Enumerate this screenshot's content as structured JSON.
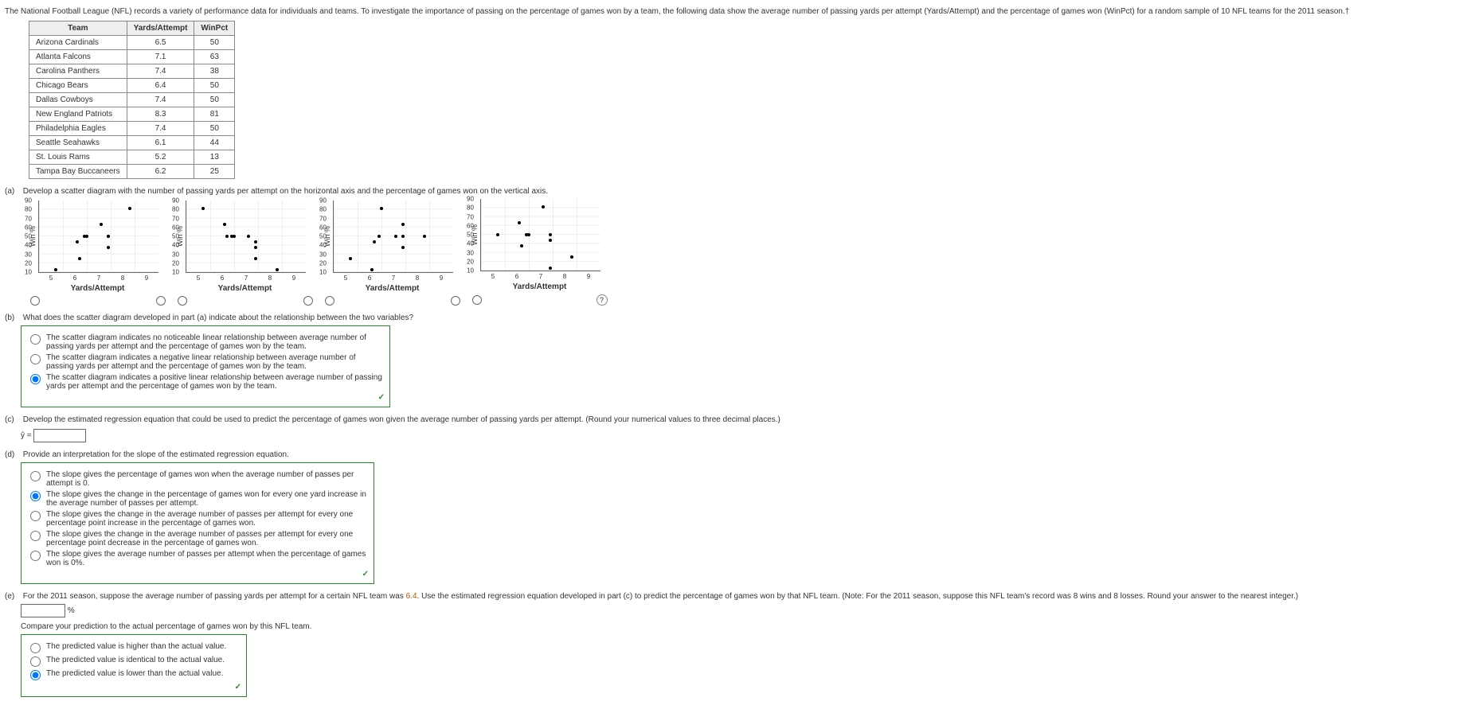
{
  "intro": "The National Football League (NFL) records a variety of performance data for individuals and teams. To investigate the importance of passing on the percentage of games won by a team, the following data show the average number of passing yards per attempt (Yards/Attempt) and the percentage of games won (WinPct) for a random sample of 10 NFL teams for the 2011 season.†",
  "table": {
    "headers": [
      "Team",
      "Yards/Attempt",
      "WinPct"
    ],
    "rows": [
      [
        "Arizona Cardinals",
        "6.5",
        "50"
      ],
      [
        "Atlanta Falcons",
        "7.1",
        "63"
      ],
      [
        "Carolina Panthers",
        "7.4",
        "38"
      ],
      [
        "Chicago Bears",
        "6.4",
        "50"
      ],
      [
        "Dallas Cowboys",
        "7.4",
        "50"
      ],
      [
        "New England Patriots",
        "8.3",
        "81"
      ],
      [
        "Philadelphia Eagles",
        "7.4",
        "50"
      ],
      [
        "Seattle Seahawks",
        "6.1",
        "44"
      ],
      [
        "St. Louis Rams",
        "5.2",
        "13"
      ],
      [
        "Tampa Bay Buccaneers",
        "6.2",
        "25"
      ]
    ]
  },
  "a": {
    "label": "(a)",
    "text": "Develop a scatter diagram with the number of passing yards per attempt on the horizontal axis and the percentage of games won on the vertical axis.",
    "ylabel": "Win %",
    "xlabel": "Yards/Attempt"
  },
  "chart_data": [
    {
      "type": "scatter",
      "xlabel": "Yards/Attempt",
      "ylabel": "Win %",
      "xlim": [
        4.5,
        9.5
      ],
      "ylim": [
        10,
        90
      ],
      "yticks": [
        10,
        20,
        30,
        40,
        50,
        60,
        70,
        80,
        90
      ],
      "xticks": [
        5,
        6,
        7,
        8,
        9
      ],
      "points": [
        [
          6.5,
          50
        ],
        [
          7.1,
          63
        ],
        [
          7.4,
          38
        ],
        [
          6.4,
          50
        ],
        [
          7.4,
          50
        ],
        [
          8.3,
          81
        ],
        [
          7.4,
          50
        ],
        [
          6.1,
          44
        ],
        [
          5.2,
          13
        ],
        [
          6.2,
          25
        ]
      ],
      "selected": false
    },
    {
      "type": "scatter",
      "xlabel": "Yards/Attempt",
      "ylabel": "Win %",
      "xlim": [
        4.5,
        9.5
      ],
      "ylim": [
        10,
        90
      ],
      "yticks": [
        10,
        20,
        30,
        40,
        50,
        60,
        70,
        80,
        90
      ],
      "xticks": [
        5,
        6,
        7,
        8,
        9
      ],
      "points": [
        [
          5.2,
          81
        ],
        [
          6.1,
          63
        ],
        [
          6.2,
          50
        ],
        [
          6.4,
          50
        ],
        [
          6.5,
          50
        ],
        [
          7.1,
          50
        ],
        [
          7.4,
          44
        ],
        [
          7.4,
          38
        ],
        [
          7.4,
          25
        ],
        [
          8.3,
          13
        ]
      ],
      "selected": false
    },
    {
      "type": "scatter",
      "xlabel": "Yards/Attempt",
      "ylabel": "Win %",
      "xlim": [
        4.5,
        9.5
      ],
      "ylim": [
        10,
        90
      ],
      "yticks": [
        10,
        20,
        30,
        40,
        50,
        60,
        70,
        80,
        90
      ],
      "xticks": [
        5,
        6,
        7,
        8,
        9
      ],
      "points": [
        [
          8.3,
          50
        ],
        [
          7.4,
          63
        ],
        [
          7.4,
          38
        ],
        [
          7.4,
          50
        ],
        [
          7.1,
          50
        ],
        [
          6.5,
          81
        ],
        [
          6.4,
          50
        ],
        [
          6.2,
          44
        ],
        [
          6.1,
          13
        ],
        [
          5.2,
          25
        ]
      ],
      "selected": false
    },
    {
      "type": "scatter",
      "xlabel": "Yards/Attempt",
      "ylabel": "Win %",
      "xlim": [
        4.5,
        9.5
      ],
      "ylim": [
        10,
        90
      ],
      "yticks": [
        10,
        20,
        30,
        40,
        50,
        60,
        70,
        80,
        90
      ],
      "xticks": [
        5,
        6,
        7,
        8,
        9
      ],
      "points": [
        [
          5.2,
          50
        ],
        [
          6.1,
          63
        ],
        [
          6.2,
          38
        ],
        [
          6.4,
          50
        ],
        [
          6.5,
          50
        ],
        [
          7.1,
          81
        ],
        [
          7.4,
          50
        ],
        [
          7.4,
          44
        ],
        [
          7.4,
          13
        ],
        [
          8.3,
          25
        ]
      ],
      "selected": false
    }
  ],
  "b": {
    "label": "(b)",
    "text": "What does the scatter diagram developed in part (a) indicate about the relationship between the two variables?",
    "options": [
      {
        "text": "The scatter diagram indicates no noticeable linear relationship between average number of passing yards per attempt and the percentage of games won by the team.",
        "selected": false
      },
      {
        "text": "The scatter diagram indicates a negative linear relationship between average number of passing yards per attempt and the percentage of games won by the team.",
        "selected": false
      },
      {
        "text": "The scatter diagram indicates a positive linear relationship between average number of passing yards per attempt and the percentage of games won by the team.",
        "selected": true
      }
    ]
  },
  "c": {
    "label": "(c)",
    "text": "Develop the estimated regression equation that could be used to predict the percentage of games won given the average number of passing yards per attempt. (Round your numerical values to three decimal places.)",
    "yhat": "ŷ ="
  },
  "d": {
    "label": "(d)",
    "text": "Provide an interpretation for the slope of the estimated regression equation.",
    "options": [
      {
        "text": "The slope gives the percentage of games won when the average number of passes per attempt is 0.",
        "selected": false
      },
      {
        "text": "The slope gives the change in the percentage of games won for every one yard increase in the average number of passes per attempt.",
        "selected": true
      },
      {
        "text": "The slope gives the change in the average number of passes per attempt for every one percentage point increase in the percentage of games won.",
        "selected": false
      },
      {
        "text": "The slope gives the change in the average number of passes per attempt for every one percentage point decrease in the percentage of games won.",
        "selected": false
      },
      {
        "text": "The slope gives the average number of passes per attempt when the percentage of games won is 0%.",
        "selected": false
      }
    ]
  },
  "e": {
    "label": "(e)",
    "text1": "For the 2011 season, suppose the average number of passing yards per attempt for a certain NFL team was ",
    "val": "6.4",
    "text2": ". Use the estimated regression equation developed in part (c) to predict the percentage of games won by that NFL team. (Note: For the 2011 season, suppose this NFL team's record was 8 wins and 8 losses. Round your answer to the nearest integer.)",
    "pct": "%",
    "compare": "Compare your prediction to the actual percentage of games won by this NFL team.",
    "options": [
      {
        "text": "The predicted value is higher than the actual value.",
        "selected": false
      },
      {
        "text": "The predicted value is identical to the actual value.",
        "selected": false
      },
      {
        "text": "The predicted value is lower than the actual value.",
        "selected": true
      }
    ]
  }
}
